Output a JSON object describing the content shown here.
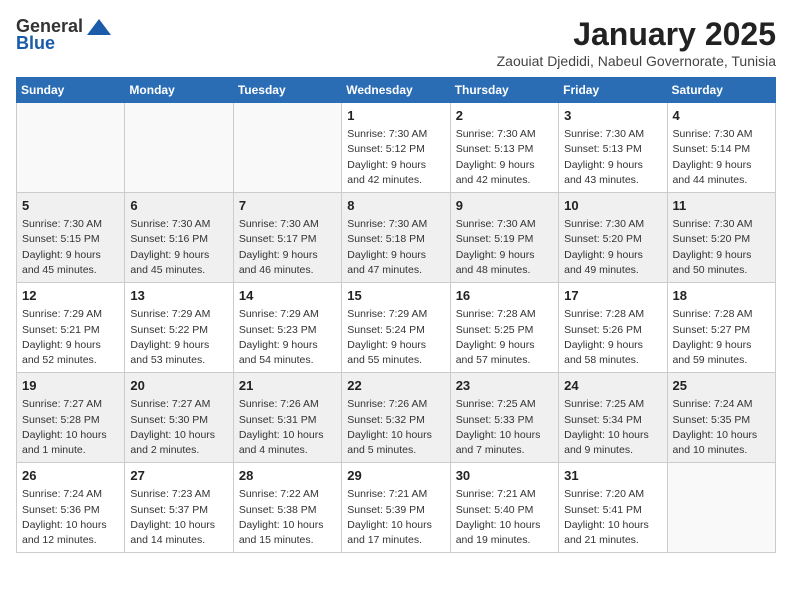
{
  "logo": {
    "general": "General",
    "blue": "Blue"
  },
  "header": {
    "title": "January 2025",
    "subtitle": "Zaouiat Djedidi, Nabeul Governorate, Tunisia"
  },
  "weekdays": [
    "Sunday",
    "Monday",
    "Tuesday",
    "Wednesday",
    "Thursday",
    "Friday",
    "Saturday"
  ],
  "weeks": [
    [
      {
        "day": "",
        "info": ""
      },
      {
        "day": "",
        "info": ""
      },
      {
        "day": "",
        "info": ""
      },
      {
        "day": "1",
        "info": "Sunrise: 7:30 AM\nSunset: 5:12 PM\nDaylight: 9 hours\nand 42 minutes."
      },
      {
        "day": "2",
        "info": "Sunrise: 7:30 AM\nSunset: 5:13 PM\nDaylight: 9 hours\nand 42 minutes."
      },
      {
        "day": "3",
        "info": "Sunrise: 7:30 AM\nSunset: 5:13 PM\nDaylight: 9 hours\nand 43 minutes."
      },
      {
        "day": "4",
        "info": "Sunrise: 7:30 AM\nSunset: 5:14 PM\nDaylight: 9 hours\nand 44 minutes."
      }
    ],
    [
      {
        "day": "5",
        "info": "Sunrise: 7:30 AM\nSunset: 5:15 PM\nDaylight: 9 hours\nand 45 minutes."
      },
      {
        "day": "6",
        "info": "Sunrise: 7:30 AM\nSunset: 5:16 PM\nDaylight: 9 hours\nand 45 minutes."
      },
      {
        "day": "7",
        "info": "Sunrise: 7:30 AM\nSunset: 5:17 PM\nDaylight: 9 hours\nand 46 minutes."
      },
      {
        "day": "8",
        "info": "Sunrise: 7:30 AM\nSunset: 5:18 PM\nDaylight: 9 hours\nand 47 minutes."
      },
      {
        "day": "9",
        "info": "Sunrise: 7:30 AM\nSunset: 5:19 PM\nDaylight: 9 hours\nand 48 minutes."
      },
      {
        "day": "10",
        "info": "Sunrise: 7:30 AM\nSunset: 5:20 PM\nDaylight: 9 hours\nand 49 minutes."
      },
      {
        "day": "11",
        "info": "Sunrise: 7:30 AM\nSunset: 5:20 PM\nDaylight: 9 hours\nand 50 minutes."
      }
    ],
    [
      {
        "day": "12",
        "info": "Sunrise: 7:29 AM\nSunset: 5:21 PM\nDaylight: 9 hours\nand 52 minutes."
      },
      {
        "day": "13",
        "info": "Sunrise: 7:29 AM\nSunset: 5:22 PM\nDaylight: 9 hours\nand 53 minutes."
      },
      {
        "day": "14",
        "info": "Sunrise: 7:29 AM\nSunset: 5:23 PM\nDaylight: 9 hours\nand 54 minutes."
      },
      {
        "day": "15",
        "info": "Sunrise: 7:29 AM\nSunset: 5:24 PM\nDaylight: 9 hours\nand 55 minutes."
      },
      {
        "day": "16",
        "info": "Sunrise: 7:28 AM\nSunset: 5:25 PM\nDaylight: 9 hours\nand 57 minutes."
      },
      {
        "day": "17",
        "info": "Sunrise: 7:28 AM\nSunset: 5:26 PM\nDaylight: 9 hours\nand 58 minutes."
      },
      {
        "day": "18",
        "info": "Sunrise: 7:28 AM\nSunset: 5:27 PM\nDaylight: 9 hours\nand 59 minutes."
      }
    ],
    [
      {
        "day": "19",
        "info": "Sunrise: 7:27 AM\nSunset: 5:28 PM\nDaylight: 10 hours\nand 1 minute."
      },
      {
        "day": "20",
        "info": "Sunrise: 7:27 AM\nSunset: 5:30 PM\nDaylight: 10 hours\nand 2 minutes."
      },
      {
        "day": "21",
        "info": "Sunrise: 7:26 AM\nSunset: 5:31 PM\nDaylight: 10 hours\nand 4 minutes."
      },
      {
        "day": "22",
        "info": "Sunrise: 7:26 AM\nSunset: 5:32 PM\nDaylight: 10 hours\nand 5 minutes."
      },
      {
        "day": "23",
        "info": "Sunrise: 7:25 AM\nSunset: 5:33 PM\nDaylight: 10 hours\nand 7 minutes."
      },
      {
        "day": "24",
        "info": "Sunrise: 7:25 AM\nSunset: 5:34 PM\nDaylight: 10 hours\nand 9 minutes."
      },
      {
        "day": "25",
        "info": "Sunrise: 7:24 AM\nSunset: 5:35 PM\nDaylight: 10 hours\nand 10 minutes."
      }
    ],
    [
      {
        "day": "26",
        "info": "Sunrise: 7:24 AM\nSunset: 5:36 PM\nDaylight: 10 hours\nand 12 minutes."
      },
      {
        "day": "27",
        "info": "Sunrise: 7:23 AM\nSunset: 5:37 PM\nDaylight: 10 hours\nand 14 minutes."
      },
      {
        "day": "28",
        "info": "Sunrise: 7:22 AM\nSunset: 5:38 PM\nDaylight: 10 hours\nand 15 minutes."
      },
      {
        "day": "29",
        "info": "Sunrise: 7:21 AM\nSunset: 5:39 PM\nDaylight: 10 hours\nand 17 minutes."
      },
      {
        "day": "30",
        "info": "Sunrise: 7:21 AM\nSunset: 5:40 PM\nDaylight: 10 hours\nand 19 minutes."
      },
      {
        "day": "31",
        "info": "Sunrise: 7:20 AM\nSunset: 5:41 PM\nDaylight: 10 hours\nand 21 minutes."
      },
      {
        "day": "",
        "info": ""
      }
    ]
  ]
}
